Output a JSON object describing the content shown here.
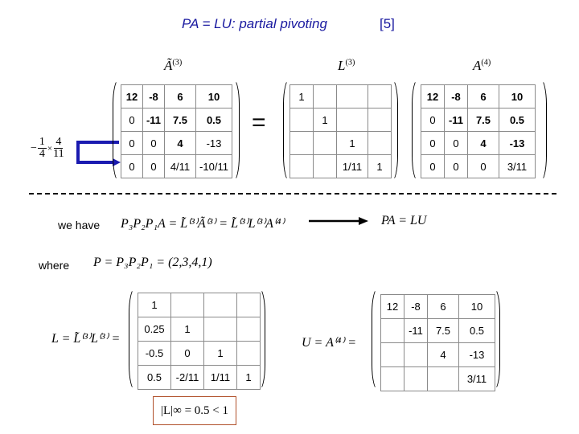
{
  "title": {
    "main": "PA = LU: partial pivoting",
    "slide_number": "[5]"
  },
  "top": {
    "multiplier_label": "−1/4 × 4/11",
    "multiplier_num1": "1",
    "multiplier_den1": "4",
    "multiplier_num2": "4",
    "multiplier_den2": "11",
    "matrix_a_tilde_3": {
      "label": "Ã",
      "sup": "(3)",
      "rows": [
        [
          "12",
          "-8",
          "6",
          "10"
        ],
        [
          "0",
          "-11",
          "7.5",
          "0.5"
        ],
        [
          "0",
          "0",
          "4",
          "-13"
        ],
        [
          "0",
          "0",
          "4/11",
          "-10/11"
        ]
      ],
      "pivot_value": "4",
      "pivot_color": "#cc3300"
    },
    "equals": "=",
    "matrix_l_3": {
      "label": "L",
      "sup": "(3)",
      "rows": [
        [
          "1",
          "",
          "",
          ""
        ],
        [
          "",
          "1",
          "",
          ""
        ],
        [
          "",
          "",
          "1",
          ""
        ],
        [
          "",
          "",
          "1/11",
          "1"
        ]
      ]
    },
    "matrix_a_4": {
      "label": "A",
      "sup": "(4)",
      "rows": [
        [
          "12",
          "-8",
          "6",
          "10"
        ],
        [
          "0",
          "-11",
          "7.5",
          "0.5"
        ],
        [
          "0",
          "0",
          "4",
          "-13"
        ],
        [
          "0",
          "0",
          "0",
          "3/11"
        ]
      ]
    }
  },
  "middle": {
    "we_have_label": "we have",
    "we_have_equation": "P₃P₂P₁A = L̃⁽³⁾Ã⁽³⁾ = L̃⁽³⁾L⁽³⁾A⁽⁴⁾",
    "result": "PA = LU",
    "where_label": "where",
    "where_equation": "P = P₃P₂P₁ = (2,3,4,1)"
  },
  "bottom": {
    "l_equation": "L = L̃⁽³⁾L⁽³⁾ =",
    "matrix_l": {
      "rows": [
        [
          "1",
          "",
          "",
          ""
        ],
        [
          "0.25",
          "1",
          "",
          ""
        ],
        [
          "-0.5",
          "0",
          "1",
          ""
        ],
        [
          "0.5",
          "-2/11",
          "1/11",
          "1"
        ]
      ]
    },
    "u_equation": "U = A⁽⁴⁾ =",
    "matrix_u": {
      "rows": [
        [
          "12",
          "-8",
          "6",
          "10"
        ],
        [
          "",
          "-11",
          "7.5",
          "0.5"
        ],
        [
          "",
          "",
          "4",
          "-13"
        ],
        [
          "",
          "",
          "",
          "3/11"
        ]
      ]
    },
    "norm_statement": "|L|∞ = 0.5 < 1"
  }
}
